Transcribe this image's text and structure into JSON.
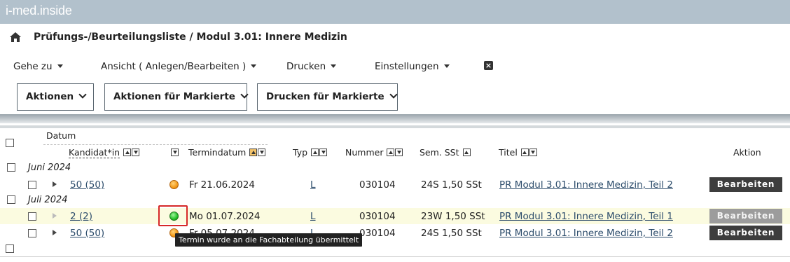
{
  "app": {
    "brand_part1": "i-med",
    "brand_sep": ".",
    "brand_part2": "inside"
  },
  "header": {
    "title": "Prüfungs-/Beurteilungsliste / Modul 3.01: Innere Medizin"
  },
  "menu": {
    "goto": "Gehe zu",
    "view": "Ansicht ( Anlegen/Bearbeiten )",
    "print": "Drucken",
    "settings": "Einstellungen"
  },
  "actions": {
    "actions": "Aktionen",
    "marked_actions": "Aktionen für Markierte",
    "marked_print": "Drucken für Markierte"
  },
  "columns": {
    "datum": "Datum",
    "candidate": "Kandidat*in",
    "date": "Termindatum",
    "type": "Typ",
    "number": "Nummer",
    "sem": "Sem. SSt",
    "title": "Titel",
    "action": "Aktion"
  },
  "groups": [
    {
      "label": "Juni 2024"
    },
    {
      "label": "Juli 2024"
    }
  ],
  "rows": [
    {
      "candidates": "50 (50)",
      "status_icon": "orange-status-icon",
      "date": "Fr 21.06.2024",
      "type": "L",
      "number": "030104",
      "sem": "24S 1,50 SSt",
      "title": "PR Modul 3.01: Innere Medizin, Teil 2",
      "action": "Bearbeiten"
    },
    {
      "candidates": "2 (2)",
      "status_icon": "green-status-icon",
      "date": "Mo 01.07.2024",
      "type": "L",
      "number": "030104",
      "sem": "23W 1,50 SSt",
      "title": "PR Modul 3.01: Innere Medizin, Teil 1",
      "action": "Bearbeiten"
    },
    {
      "candidates": "50 (50)",
      "status_icon": "orange-status-icon",
      "date": "Fr 05.07.2024",
      "type": "L",
      "number": "030104",
      "sem": "24S 1,50 SSt",
      "title": "PR Modul 3.01: Innere Medizin, Teil 2",
      "action": "Bearbeiten"
    }
  ],
  "tooltip": "Termin wurde an die Fachabteilung übermittelt",
  "colors": {
    "topbar": "#b2c1cc",
    "highlight_row": "#fbfbe0",
    "button_dark": "#3d3d3d",
    "button_disabled": "#9c9c9c",
    "status_green": "#26c22a",
    "status_orange": "#f39a18",
    "marker_red": "#d62828"
  }
}
